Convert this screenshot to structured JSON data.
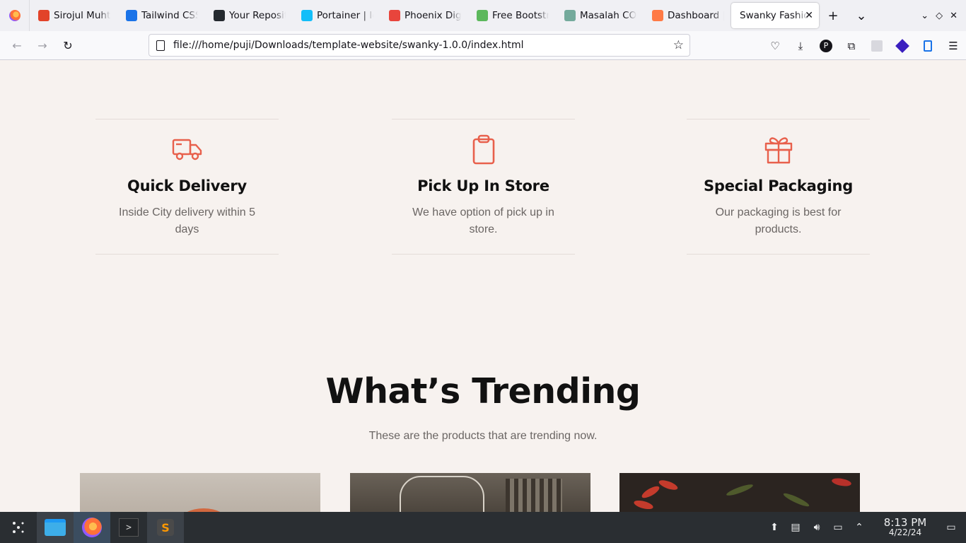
{
  "browser": {
    "tabs": [
      {
        "label": "Sirojul Muhta",
        "favicon_color": "#e24329"
      },
      {
        "label": "Tailwind CSS",
        "favicon_color": "#1a73e8"
      },
      {
        "label": "Your Reposit",
        "favicon_color": "#24292f"
      },
      {
        "label": "Portainer | lo",
        "favicon_color": "#13bef9"
      },
      {
        "label": "Phoenix Digi",
        "favicon_color": "#e8453c"
      },
      {
        "label": "Free Bootstra",
        "favicon_color": "#5cb85c"
      },
      {
        "label": "Masalah COR",
        "favicon_color": "#74aa9c"
      },
      {
        "label": "Dashboard |",
        "favicon_color": "#ff7a45"
      },
      {
        "label": "Swanky Fashio",
        "active": true
      }
    ],
    "url": "file:///home/puji/Downloads/template-website/swanky-1.0.0/index.html"
  },
  "features": [
    {
      "title": "Quick Delivery",
      "text": "Inside City delivery within 5 days",
      "icon": "truck-icon"
    },
    {
      "title": "Pick Up In Store",
      "text": "We have option of pick up in store.",
      "icon": "clipboard-icon"
    },
    {
      "title": "Special Packaging",
      "text": "Our packaging is best for products.",
      "icon": "gift-icon"
    }
  ],
  "trending": {
    "title": "What’s Trending",
    "subtitle": "These are the products that are trending now."
  },
  "taskbar": {
    "time": "8:13 PM",
    "date": "4/22/24"
  },
  "colors": {
    "accent": "#e8604c",
    "page_bg": "#f7f2ef"
  }
}
